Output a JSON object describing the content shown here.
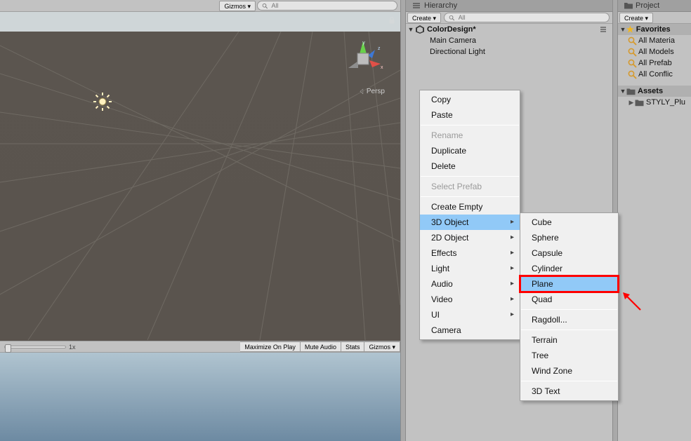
{
  "scene_toolbar": {
    "gizmos_label": "Gizmos ▾",
    "search_placeholder": "All"
  },
  "scene_view": {
    "persp_label": "Persp",
    "axis_x": "x",
    "axis_y": "y",
    "axis_z": "z"
  },
  "game_toolbar": {
    "zoom_label": "1x",
    "maximize": "Maximize On Play",
    "mute": "Mute Audio",
    "stats": "Stats",
    "gizmos": "Gizmos ▾"
  },
  "hierarchy": {
    "panel_title": "Hierarchy",
    "create_label": "Create ▾",
    "search_placeholder": "All",
    "scene_name": "ColorDesign*",
    "items": [
      "Main Camera",
      "Directional Light"
    ]
  },
  "project": {
    "panel_title": "Project",
    "create_label": "Create ▾",
    "favorites_label": "Favorites",
    "favorites": [
      "All Materia",
      "All Models",
      "All Prefab",
      "All Conflic"
    ],
    "assets_label": "Assets",
    "folders": [
      "STYLY_Plu"
    ]
  },
  "context_menu": {
    "copy": "Copy",
    "paste": "Paste",
    "rename": "Rename",
    "duplicate": "Duplicate",
    "delete": "Delete",
    "select_prefab": "Select Prefab",
    "create_empty": "Create Empty",
    "obj3d": "3D Object",
    "obj2d": "2D Object",
    "effects": "Effects",
    "light": "Light",
    "audio": "Audio",
    "video": "Video",
    "ui": "UI",
    "camera": "Camera"
  },
  "submenu_3d": {
    "cube": "Cube",
    "sphere": "Sphere",
    "capsule": "Capsule",
    "cylinder": "Cylinder",
    "plane": "Plane",
    "quad": "Quad",
    "ragdoll": "Ragdoll...",
    "terrain": "Terrain",
    "tree": "Tree",
    "wind_zone": "Wind Zone",
    "text3d": "3D Text"
  }
}
